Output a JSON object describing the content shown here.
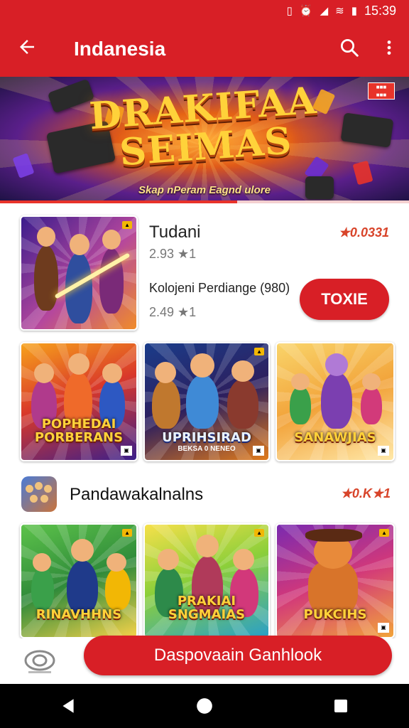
{
  "status_bar": {
    "time": "15:39"
  },
  "app_bar": {
    "title": "Indanesia"
  },
  "banner": {
    "headline_line1": "DRAKIFAA",
    "headline_line2": "SEIMAS",
    "tagline": "Skap nPeram Eagnd ulore",
    "progress": 0.58
  },
  "featured": {
    "title": "Tudani",
    "score_1": "2.93 ★1",
    "description": "Kolojeni Perdiange (980)",
    "score_2": "2.49 ★1",
    "rank": "★0.0331",
    "action_label": "TOXIE",
    "art_title": ""
  },
  "grid_row_1": [
    {
      "art_title": "POPHEDAI PORBERANS",
      "art_sub": ""
    },
    {
      "art_title": "UPRIHSIRAD",
      "art_sub": "BEKSA 0 NENEO"
    },
    {
      "art_title": "SANAWJIAS",
      "art_sub": ""
    }
  ],
  "section": {
    "name": "Pandawakalnalns",
    "rank": "★0.K★1"
  },
  "grid_row_2": [
    {
      "art_title": "RINAVHHNS",
      "art_sub": ""
    },
    {
      "art_title": "PRAKIAI SNGMAIAS",
      "art_sub": ""
    },
    {
      "art_title": "PUKCIHS",
      "art_sub": ""
    }
  ],
  "cta": {
    "label": "Daspovaain Ganhlook"
  },
  "colors": {
    "primary": "#d81f26",
    "rank_text": "#d8442a"
  },
  "icons": {
    "back": "arrow-left-icon",
    "search": "search-icon",
    "more": "more-vert-icon",
    "nav_back": "triangle-back-icon",
    "nav_home": "circle-home-icon",
    "nav_recents": "square-recents-icon"
  }
}
